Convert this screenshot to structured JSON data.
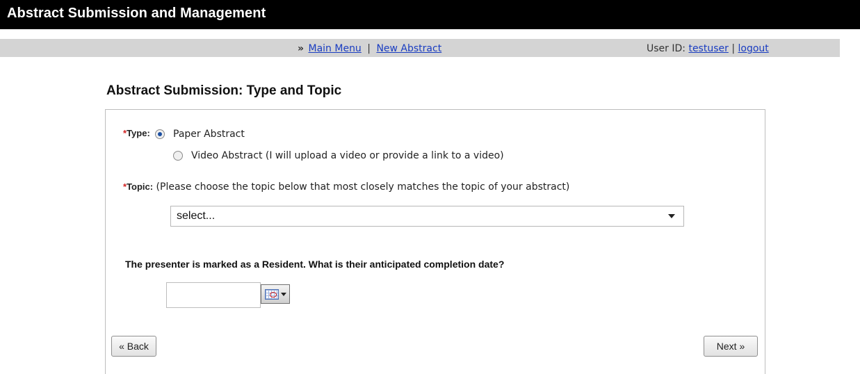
{
  "header": {
    "title": "Abstract Submission and Management"
  },
  "nav": {
    "raquo": "»",
    "main_menu": "Main Menu",
    "separator": "|",
    "new_abstract": "New Abstract",
    "user_label": "User ID:",
    "user_id": "testuser",
    "logout": "logout"
  },
  "page": {
    "heading": "Abstract Submission: Type and Topic"
  },
  "form": {
    "required_mark": "*",
    "type_label": "Type:",
    "type_options": [
      {
        "label": "Paper Abstract",
        "selected": true
      },
      {
        "label": "Video Abstract (I will upload a video or provide a link to a video)",
        "selected": false
      }
    ],
    "topic_label": "Topic:",
    "topic_hint": "(Please choose the topic below that most closely matches the topic of your abstract)",
    "topic_select_value": "select...",
    "completion_question": "The presenter is marked as a Resident. What is their anticipated completion date?",
    "completion_date_value": ""
  },
  "buttons": {
    "back": "« Back",
    "next": "Next »"
  }
}
